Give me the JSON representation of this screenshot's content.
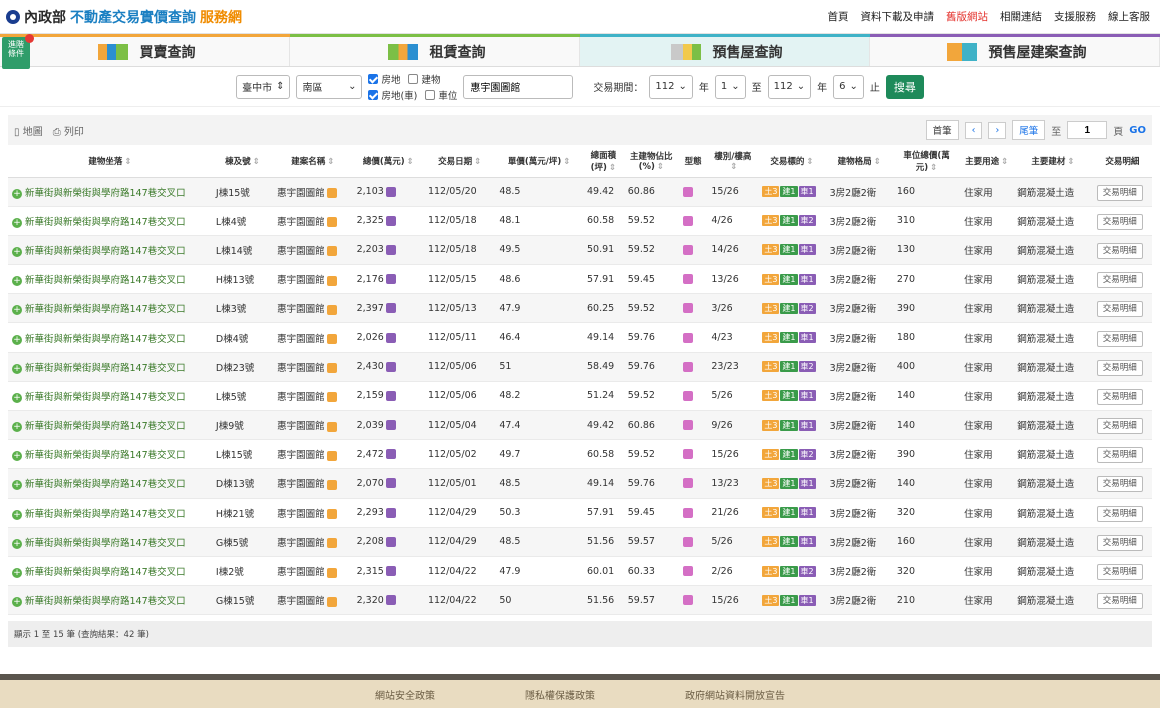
{
  "header": {
    "ministry": "內政部",
    "title": "不動產交易實價查詢",
    "service": "服務網",
    "nav": [
      "首頁",
      "資料下載及申請",
      "舊版網站",
      "相關連結",
      "支援服務",
      "線上客服"
    ]
  },
  "tool_badge": {
    "line1": "進階",
    "line2": "條件"
  },
  "tabs": [
    "買賣查詢",
    "租賃查詢",
    "預售屋查詢",
    "預售屋建案查詢"
  ],
  "search": {
    "city": "臺中市",
    "district": "南區",
    "check_land": "房地",
    "check_building": "建物",
    "check_land_park": "房地(車)",
    "check_parking": "車位",
    "project": "惠宇園圖館",
    "period_label": "交易期間：",
    "from_year": "112",
    "year_unit": "年",
    "from_month": "1",
    "to": "至",
    "to_year": "112",
    "to_month": "6",
    "end": "止",
    "submit": "搜尋"
  },
  "toolbar": {
    "map": "地圖",
    "print": "列印",
    "first": "首筆",
    "prev": "‹",
    "next": "›",
    "last": "尾筆",
    "to": "至",
    "page": "1",
    "page_unit": "頁",
    "go": "GO"
  },
  "columns": [
    "建物坐落",
    "棟及號",
    "建案名稱",
    "總價(萬元)",
    "交易日期",
    "單價(萬元/坪)",
    "總面積(坪)",
    "主建物佔比(%)",
    "型態",
    "樓別/樓高",
    "交易標的",
    "建物格局",
    "車位總價(萬元)",
    "主要用途",
    "主要建材",
    "交易明細"
  ],
  "common": {
    "address": "新華街與新榮街與學府路147巷交叉口",
    "project": "惠宇園圖館",
    "layout": "3房2廳2衛",
    "use": "住家用",
    "material": "鋼筋混凝土造",
    "detail": "交易明細"
  },
  "rows": [
    {
      "unit": "J棟15號",
      "price": "2,103",
      "date": "112/05/20",
      "unit_price": "48.5",
      "area": "49.42",
      "ratio": "60.86",
      "floor": "15/26",
      "l": "3",
      "b": "1",
      "p": "1",
      "park_price": "160"
    },
    {
      "unit": "L棟4號",
      "price": "2,325",
      "date": "112/05/18",
      "unit_price": "48.1",
      "area": "60.58",
      "ratio": "59.52",
      "floor": "4/26",
      "l": "3",
      "b": "1",
      "p": "2",
      "park_price": "310"
    },
    {
      "unit": "L棟14號",
      "price": "2,203",
      "date": "112/05/18",
      "unit_price": "49.5",
      "area": "50.91",
      "ratio": "59.52",
      "floor": "14/26",
      "l": "3",
      "b": "1",
      "p": "1",
      "park_price": "130"
    },
    {
      "unit": "H棟13號",
      "price": "2,176",
      "date": "112/05/15",
      "unit_price": "48.6",
      "area": "57.91",
      "ratio": "59.45",
      "floor": "13/26",
      "l": "3",
      "b": "1",
      "p": "1",
      "park_price": "270"
    },
    {
      "unit": "L棟3號",
      "price": "2,397",
      "date": "112/05/13",
      "unit_price": "47.9",
      "area": "60.25",
      "ratio": "59.52",
      "floor": "3/26",
      "l": "3",
      "b": "1",
      "p": "2",
      "park_price": "390"
    },
    {
      "unit": "D棟4號",
      "price": "2,026",
      "date": "112/05/11",
      "unit_price": "46.4",
      "area": "49.14",
      "ratio": "59.76",
      "floor": "4/23",
      "l": "3",
      "b": "1",
      "p": "1",
      "park_price": "180"
    },
    {
      "unit": "D棟23號",
      "price": "2,430",
      "date": "112/05/06",
      "unit_price": "51",
      "area": "58.49",
      "ratio": "59.76",
      "floor": "23/23",
      "l": "3",
      "b": "1",
      "p": "2",
      "park_price": "400"
    },
    {
      "unit": "L棟5號",
      "price": "2,159",
      "date": "112/05/06",
      "unit_price": "48.2",
      "area": "51.24",
      "ratio": "59.52",
      "floor": "5/26",
      "l": "3",
      "b": "1",
      "p": "1",
      "park_price": "140"
    },
    {
      "unit": "J棟9號",
      "price": "2,039",
      "date": "112/05/04",
      "unit_price": "47.4",
      "area": "49.42",
      "ratio": "60.86",
      "floor": "9/26",
      "l": "3",
      "b": "1",
      "p": "1",
      "park_price": "140"
    },
    {
      "unit": "L棟15號",
      "price": "2,472",
      "date": "112/05/02",
      "unit_price": "49.7",
      "area": "60.58",
      "ratio": "59.52",
      "floor": "15/26",
      "l": "3",
      "b": "1",
      "p": "2",
      "park_price": "390"
    },
    {
      "unit": "D棟13號",
      "price": "2,070",
      "date": "112/05/01",
      "unit_price": "48.5",
      "area": "49.14",
      "ratio": "59.76",
      "floor": "13/23",
      "l": "3",
      "b": "1",
      "p": "1",
      "park_price": "140"
    },
    {
      "unit": "H棟21號",
      "price": "2,293",
      "date": "112/04/29",
      "unit_price": "50.3",
      "area": "57.91",
      "ratio": "59.45",
      "floor": "21/26",
      "l": "3",
      "b": "1",
      "p": "1",
      "park_price": "320"
    },
    {
      "unit": "G棟5號",
      "price": "2,208",
      "date": "112/04/29",
      "unit_price": "48.5",
      "area": "51.56",
      "ratio": "59.57",
      "floor": "5/26",
      "l": "3",
      "b": "1",
      "p": "1",
      "park_price": "160"
    },
    {
      "unit": "I棟2號",
      "price": "2,315",
      "date": "112/04/22",
      "unit_price": "47.9",
      "area": "60.01",
      "ratio": "60.33",
      "floor": "2/26",
      "l": "3",
      "b": "1",
      "p": "2",
      "park_price": "320"
    },
    {
      "unit": "G棟15號",
      "price": "2,320",
      "date": "112/04/22",
      "unit_price": "50",
      "area": "51.56",
      "ratio": "59.57",
      "floor": "15/26",
      "l": "3",
      "b": "1",
      "p": "1",
      "park_price": "210"
    }
  ],
  "chip_labels": {
    "land": "土",
    "building": "建",
    "parking": "車"
  },
  "summary": "顯示 1 至 15 筆 (查詢結果：42 筆)",
  "footer": [
    "網站安全政策",
    "隱私權保護政策",
    "政府網站資料開放宣告"
  ]
}
